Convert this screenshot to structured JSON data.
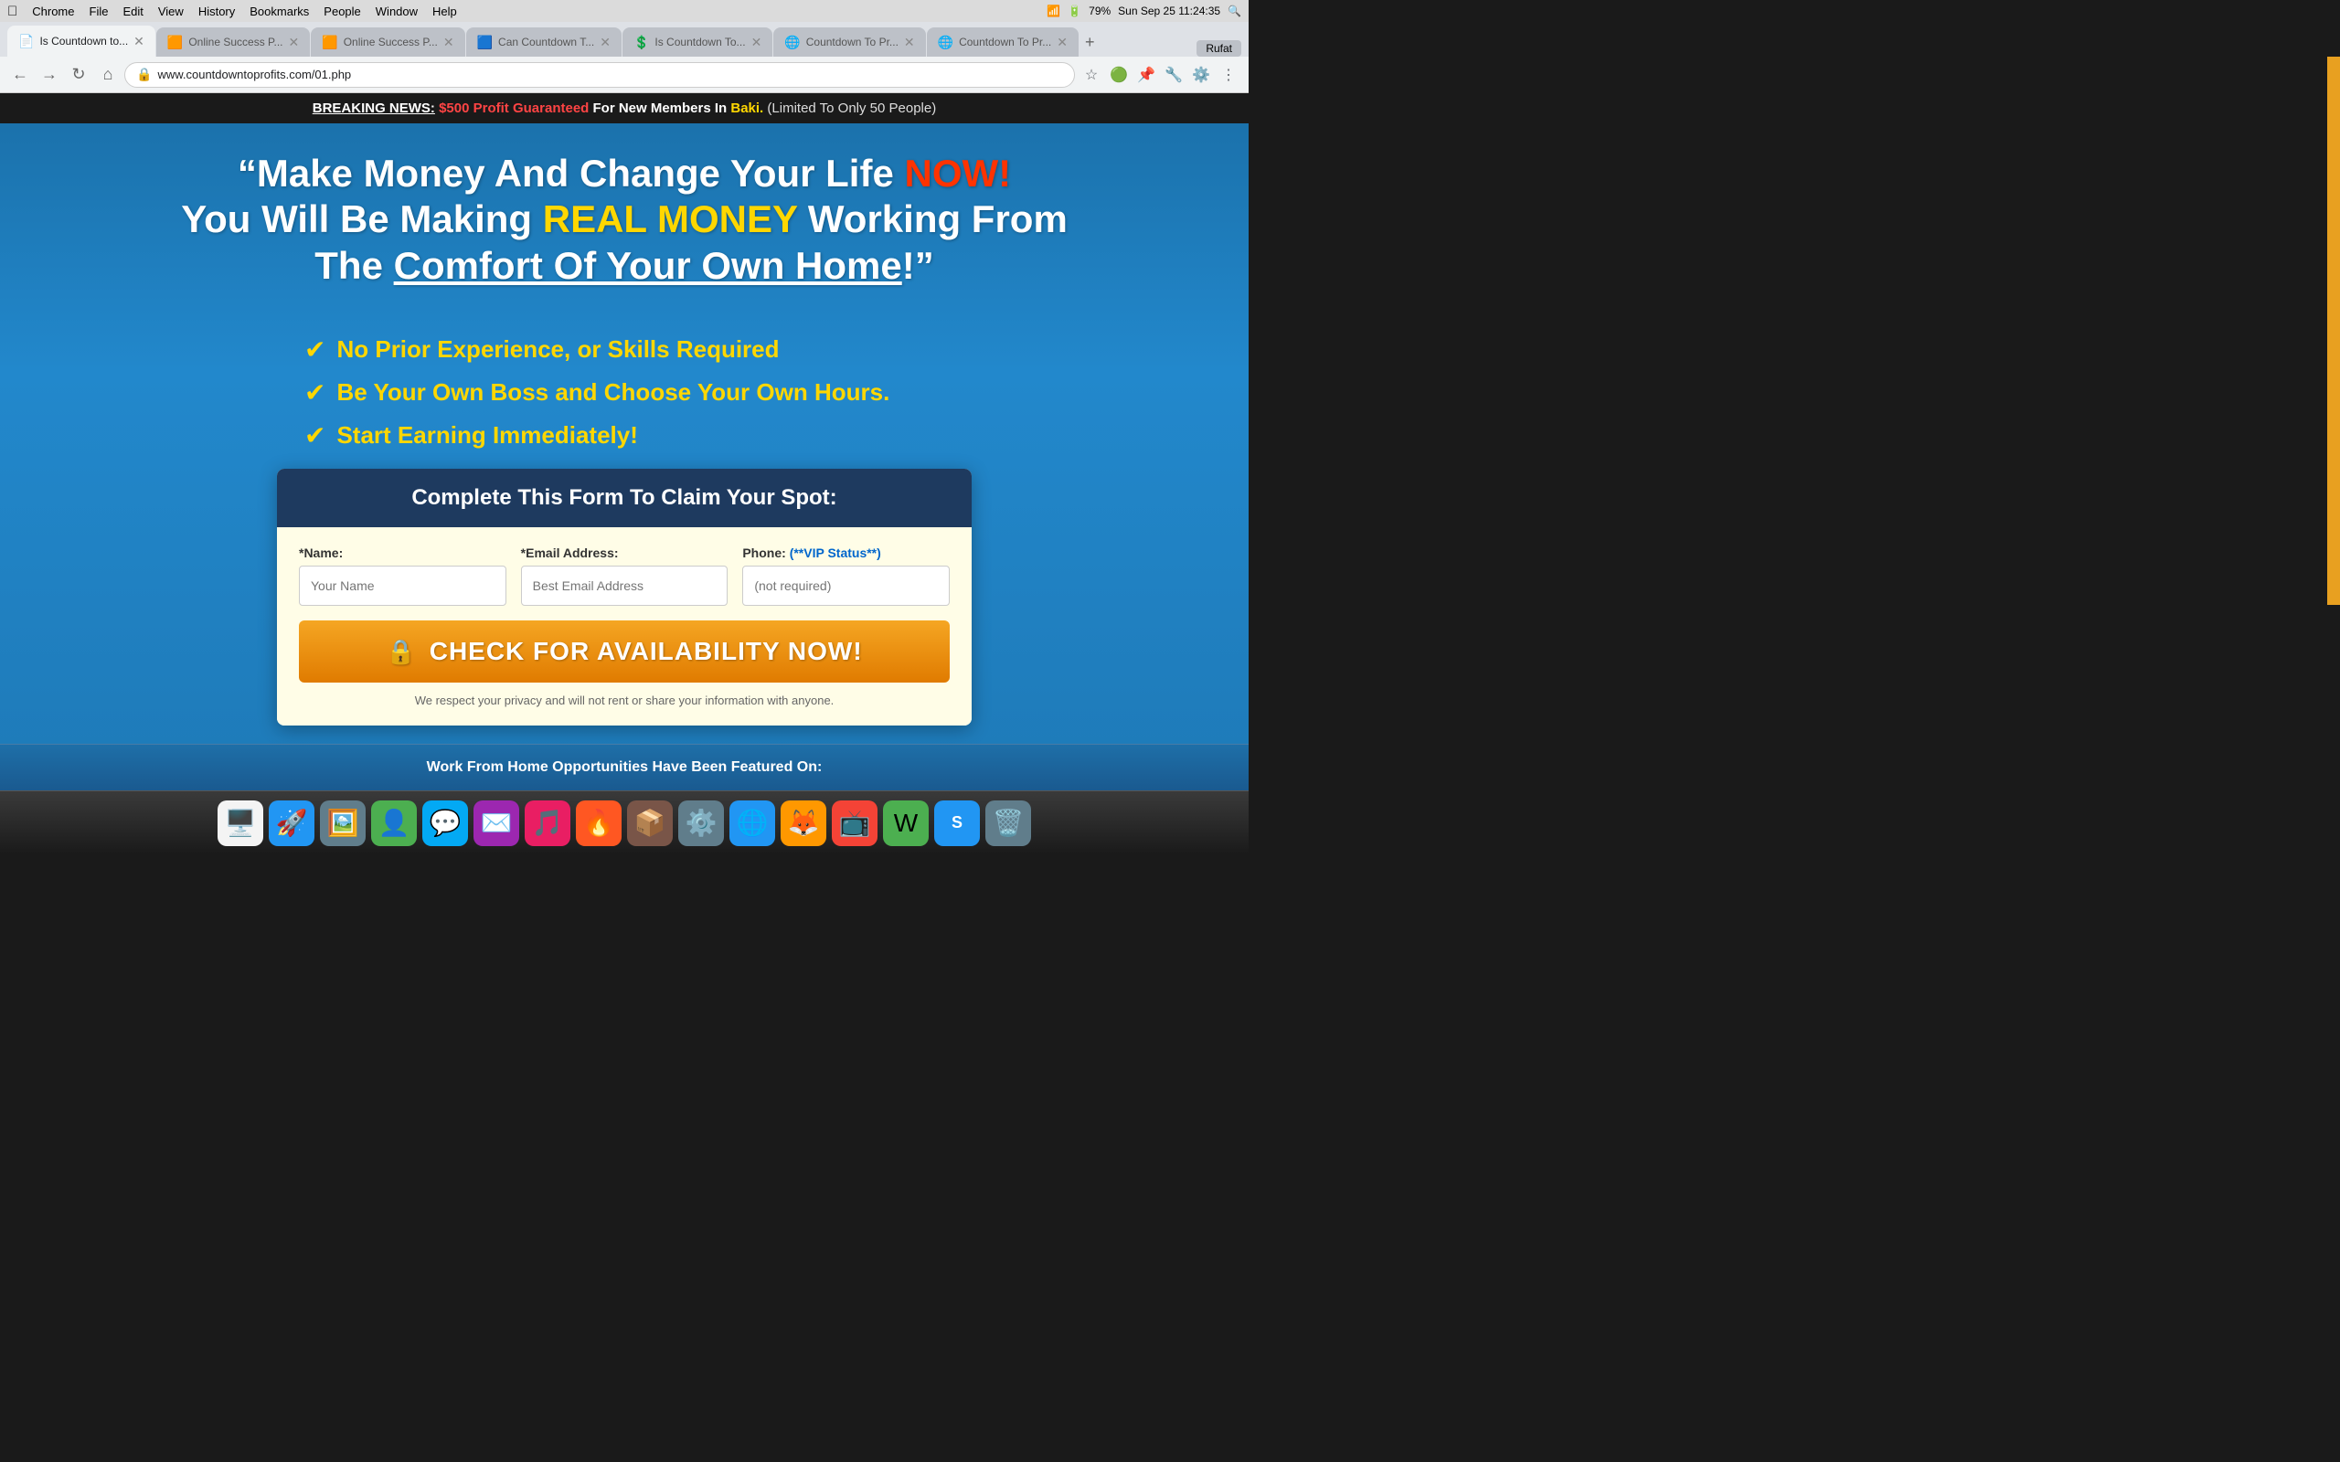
{
  "menubar": {
    "apple": "&#xF8FF;",
    "items": [
      "Chrome",
      "File",
      "Edit",
      "View",
      "History",
      "Bookmarks",
      "People",
      "Window",
      "Help"
    ],
    "right": {
      "datetime": "Sun Sep 25  11:24:35",
      "battery": "79%"
    }
  },
  "tabs": [
    {
      "id": "tab1",
      "favicon": "📄",
      "title": "Is Countdown to...",
      "active": true
    },
    {
      "id": "tab2",
      "favicon": "🟧",
      "title": "Online Success P...",
      "active": false
    },
    {
      "id": "tab3",
      "favicon": "🟧",
      "title": "Online Success P...",
      "active": false
    },
    {
      "id": "tab4",
      "favicon": "🟦",
      "title": "Can Countdown T...",
      "active": false
    },
    {
      "id": "tab5",
      "favicon": "💲",
      "title": "Is Countdown To...",
      "active": false
    },
    {
      "id": "tab6",
      "favicon": "🌐",
      "title": "Countdown To Pr...",
      "active": false
    },
    {
      "id": "tab7",
      "favicon": "🌐",
      "title": "Countdown To Pr...",
      "active": false
    }
  ],
  "profile_label": "Rufat",
  "address_bar": {
    "url": "www.countdowntoprofits.com/01.php",
    "lock_icon": "🔒"
  },
  "page": {
    "breaking_news": {
      "label": "BREAKING NEWS:",
      "profit_text": "$500 Profit Guaranteed",
      "middle_text": " For New Members In ",
      "city": "Baki.",
      "paren_text": " (Limited To Only 50 People)"
    },
    "hero": {
      "line1": "“Make Money And Change Your Life ",
      "now": "NOW!",
      "line2": "You Will Be Making ",
      "real_money": "REAL MONEY",
      "line2b": " Working From",
      "line3_pre": "The ",
      "comfort": "Comfort Of Your Own Home",
      "line3_post": "!”"
    },
    "bullets": [
      "No Prior Experience, or Skills Required",
      "Be Your Own Boss and Choose Your Own Hours.",
      "Start Earning Immediately!"
    ],
    "form": {
      "header": "Complete This Form To Claim Your Spot:",
      "name_label": "*Name:",
      "name_placeholder": "Your Name",
      "email_label": "*Email Address:",
      "email_placeholder": "Best Email Address",
      "phone_label": "Phone:",
      "phone_vip": "(**VIP Status**)",
      "phone_placeholder": "(not required)",
      "submit_label": "CHECK FOR AVAILABILITY NOW!",
      "lock_icon": "🔒",
      "privacy_text": "We respect your privacy and will not rent or share your information with anyone."
    },
    "featured": "Work From Home Opportunities Have Been Featured On:"
  }
}
